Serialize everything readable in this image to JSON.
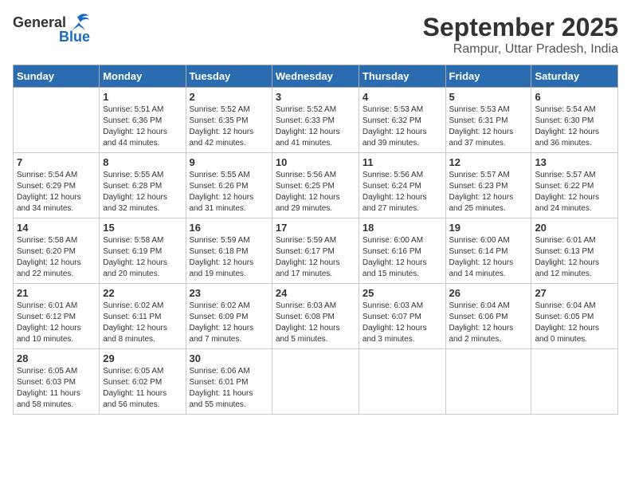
{
  "logo": {
    "general": "General",
    "blue": "Blue"
  },
  "title": "September 2025",
  "subtitle": "Rampur, Uttar Pradesh, India",
  "days_of_week": [
    "Sunday",
    "Monday",
    "Tuesday",
    "Wednesday",
    "Thursday",
    "Friday",
    "Saturday"
  ],
  "weeks": [
    [
      {
        "day": "",
        "info": ""
      },
      {
        "day": "1",
        "info": "Sunrise: 5:51 AM\nSunset: 6:36 PM\nDaylight: 12 hours\nand 44 minutes."
      },
      {
        "day": "2",
        "info": "Sunrise: 5:52 AM\nSunset: 6:35 PM\nDaylight: 12 hours\nand 42 minutes."
      },
      {
        "day": "3",
        "info": "Sunrise: 5:52 AM\nSunset: 6:33 PM\nDaylight: 12 hours\nand 41 minutes."
      },
      {
        "day": "4",
        "info": "Sunrise: 5:53 AM\nSunset: 6:32 PM\nDaylight: 12 hours\nand 39 minutes."
      },
      {
        "day": "5",
        "info": "Sunrise: 5:53 AM\nSunset: 6:31 PM\nDaylight: 12 hours\nand 37 minutes."
      },
      {
        "day": "6",
        "info": "Sunrise: 5:54 AM\nSunset: 6:30 PM\nDaylight: 12 hours\nand 36 minutes."
      }
    ],
    [
      {
        "day": "7",
        "info": "Sunrise: 5:54 AM\nSunset: 6:29 PM\nDaylight: 12 hours\nand 34 minutes."
      },
      {
        "day": "8",
        "info": "Sunrise: 5:55 AM\nSunset: 6:28 PM\nDaylight: 12 hours\nand 32 minutes."
      },
      {
        "day": "9",
        "info": "Sunrise: 5:55 AM\nSunset: 6:26 PM\nDaylight: 12 hours\nand 31 minutes."
      },
      {
        "day": "10",
        "info": "Sunrise: 5:56 AM\nSunset: 6:25 PM\nDaylight: 12 hours\nand 29 minutes."
      },
      {
        "day": "11",
        "info": "Sunrise: 5:56 AM\nSunset: 6:24 PM\nDaylight: 12 hours\nand 27 minutes."
      },
      {
        "day": "12",
        "info": "Sunrise: 5:57 AM\nSunset: 6:23 PM\nDaylight: 12 hours\nand 25 minutes."
      },
      {
        "day": "13",
        "info": "Sunrise: 5:57 AM\nSunset: 6:22 PM\nDaylight: 12 hours\nand 24 minutes."
      }
    ],
    [
      {
        "day": "14",
        "info": "Sunrise: 5:58 AM\nSunset: 6:20 PM\nDaylight: 12 hours\nand 22 minutes."
      },
      {
        "day": "15",
        "info": "Sunrise: 5:58 AM\nSunset: 6:19 PM\nDaylight: 12 hours\nand 20 minutes."
      },
      {
        "day": "16",
        "info": "Sunrise: 5:59 AM\nSunset: 6:18 PM\nDaylight: 12 hours\nand 19 minutes."
      },
      {
        "day": "17",
        "info": "Sunrise: 5:59 AM\nSunset: 6:17 PM\nDaylight: 12 hours\nand 17 minutes."
      },
      {
        "day": "18",
        "info": "Sunrise: 6:00 AM\nSunset: 6:16 PM\nDaylight: 12 hours\nand 15 minutes."
      },
      {
        "day": "19",
        "info": "Sunrise: 6:00 AM\nSunset: 6:14 PM\nDaylight: 12 hours\nand 14 minutes."
      },
      {
        "day": "20",
        "info": "Sunrise: 6:01 AM\nSunset: 6:13 PM\nDaylight: 12 hours\nand 12 minutes."
      }
    ],
    [
      {
        "day": "21",
        "info": "Sunrise: 6:01 AM\nSunset: 6:12 PM\nDaylight: 12 hours\nand 10 minutes."
      },
      {
        "day": "22",
        "info": "Sunrise: 6:02 AM\nSunset: 6:11 PM\nDaylight: 12 hours\nand 8 minutes."
      },
      {
        "day": "23",
        "info": "Sunrise: 6:02 AM\nSunset: 6:09 PM\nDaylight: 12 hours\nand 7 minutes."
      },
      {
        "day": "24",
        "info": "Sunrise: 6:03 AM\nSunset: 6:08 PM\nDaylight: 12 hours\nand 5 minutes."
      },
      {
        "day": "25",
        "info": "Sunrise: 6:03 AM\nSunset: 6:07 PM\nDaylight: 12 hours\nand 3 minutes."
      },
      {
        "day": "26",
        "info": "Sunrise: 6:04 AM\nSunset: 6:06 PM\nDaylight: 12 hours\nand 2 minutes."
      },
      {
        "day": "27",
        "info": "Sunrise: 6:04 AM\nSunset: 6:05 PM\nDaylight: 12 hours\nand 0 minutes."
      }
    ],
    [
      {
        "day": "28",
        "info": "Sunrise: 6:05 AM\nSunset: 6:03 PM\nDaylight: 11 hours\nand 58 minutes."
      },
      {
        "day": "29",
        "info": "Sunrise: 6:05 AM\nSunset: 6:02 PM\nDaylight: 11 hours\nand 56 minutes."
      },
      {
        "day": "30",
        "info": "Sunrise: 6:06 AM\nSunset: 6:01 PM\nDaylight: 11 hours\nand 55 minutes."
      },
      {
        "day": "",
        "info": ""
      },
      {
        "day": "",
        "info": ""
      },
      {
        "day": "",
        "info": ""
      },
      {
        "day": "",
        "info": ""
      }
    ]
  ]
}
